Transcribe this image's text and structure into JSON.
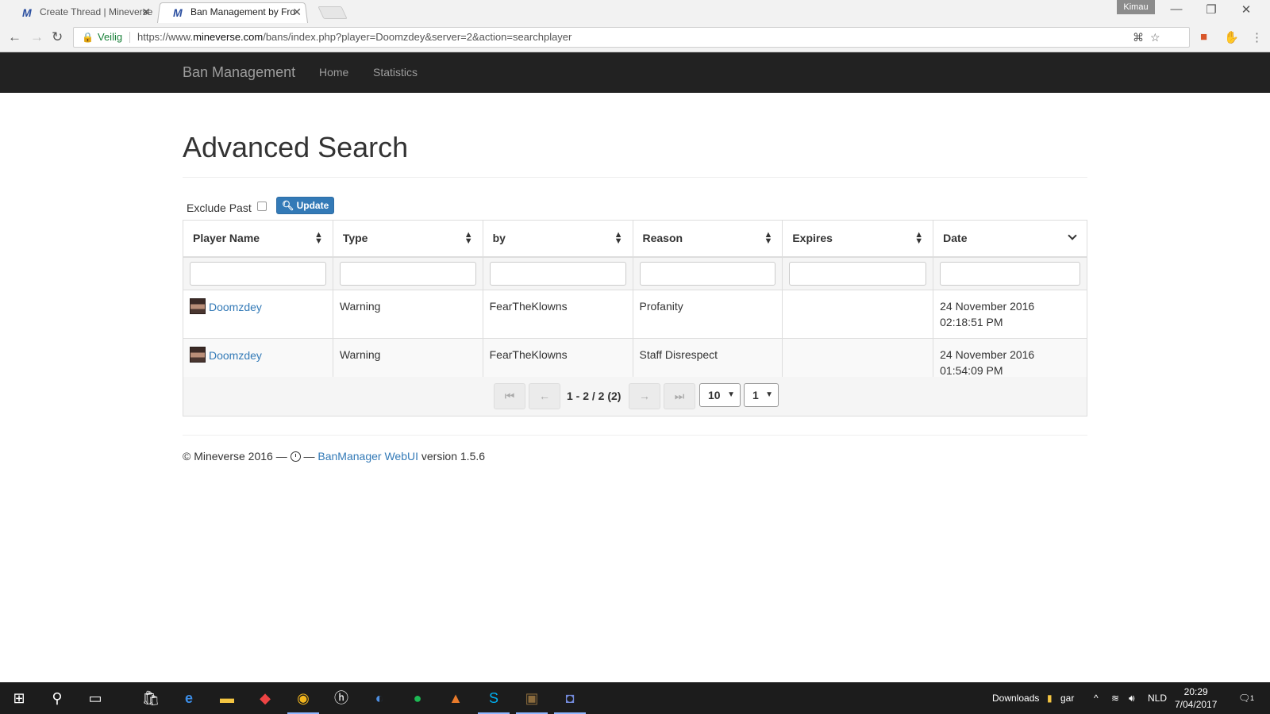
{
  "browser": {
    "tabs": [
      {
        "title": "Create Thread | Mineverse",
        "active": false
      },
      {
        "title": "Ban Management by Fro",
        "active": true
      }
    ],
    "user": "Kimau",
    "security_label": "Veilig",
    "url_prefix": "https://www.",
    "url_host": "mineverse.com",
    "url_path": "/bans/index.php?player=Doomzdey&server=2&action=searchplayer"
  },
  "navbar": {
    "brand": "Ban Management",
    "links": [
      "Home",
      "Statistics"
    ]
  },
  "page": {
    "title": "Advanced Search",
    "exclude_past_label": "Exclude Past",
    "update_label": "Update"
  },
  "table": {
    "columns": [
      "Player Name",
      "Type",
      "by",
      "Reason",
      "Expires",
      "Date"
    ],
    "rows": [
      {
        "player": "Doomzdey",
        "type": "Warning",
        "by": "FearTheKlowns",
        "reason": "Profanity",
        "expires": "",
        "date_line1": "24 November 2016",
        "date_line2": "02:18:51 PM"
      },
      {
        "player": "Doomzdey",
        "type": "Warning",
        "by": "FearTheKlowns",
        "reason": "Staff Disrespect",
        "expires": "",
        "date_line1": "24 November 2016",
        "date_line2": "01:54:09 PM"
      }
    ]
  },
  "pager": {
    "info": "1 - 2 / 2 (2)",
    "page_size": "10",
    "page": "1"
  },
  "footer": {
    "copyright": "© Mineverse 2016 —",
    "dash": "—",
    "link": "BanManager WebUI",
    "version": "version 1.5.6"
  },
  "taskbar": {
    "downloads_label": "Downloads",
    "folder_label": "gar",
    "language": "NLD",
    "time": "20:29",
    "date": "7/04/2017",
    "notification_count": "1"
  }
}
